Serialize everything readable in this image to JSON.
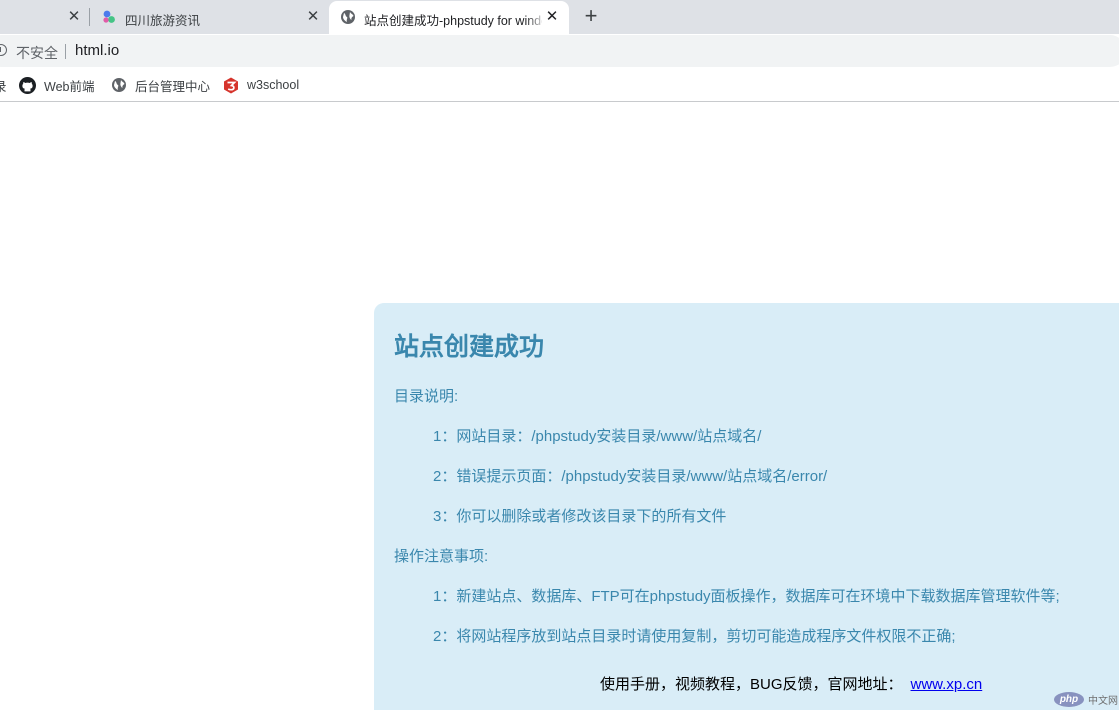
{
  "browser": {
    "tabs": [
      {
        "title": "",
        "active": false
      },
      {
        "title": "四川旅游资讯",
        "active": false
      },
      {
        "title": "站点创建成功-phpstudy for windows",
        "active": true
      }
    ],
    "close_glyph": "✕",
    "new_tab_glyph": "+",
    "security_label": "不安全",
    "url": "html.io",
    "bookmarks": [
      {
        "label": "录",
        "icon": "bookmark-icon"
      },
      {
        "label": "Web前端",
        "icon": "github-icon"
      },
      {
        "label": "后台管理中心",
        "icon": "globe-icon"
      },
      {
        "label": "w3school",
        "icon": "w3school-icon"
      }
    ]
  },
  "page": {
    "heading": "站点创建成功",
    "dir_title": "目录说明:",
    "dir_items": [
      "1：网站目录：/phpstudy安装目录/www/站点域名/",
      "2：错误提示页面：/phpstudy安装目录/www/站点域名/error/",
      "3：你可以删除或者修改该目录下的所有文件"
    ],
    "notes_title": "操作注意事项:",
    "notes_items": [
      "1：新建站点、数据库、FTP可在phpstudy面板操作，数据库可在环境中下载数据库管理软件等;",
      "2：将网站程序放到站点目录时请使用复制，剪切可能造成程序文件权限不正确;"
    ],
    "footer_text": "使用手册，视频教程，BUG反馈，官网地址：",
    "footer_link": "www.xp.cn"
  },
  "watermark": {
    "logo": "php",
    "text": "中文网"
  },
  "colors": {
    "tab_strip": "#dee1e6",
    "panel_bg": "#d9edf7",
    "panel_text": "#3a87ad",
    "link": "#0000ee"
  }
}
